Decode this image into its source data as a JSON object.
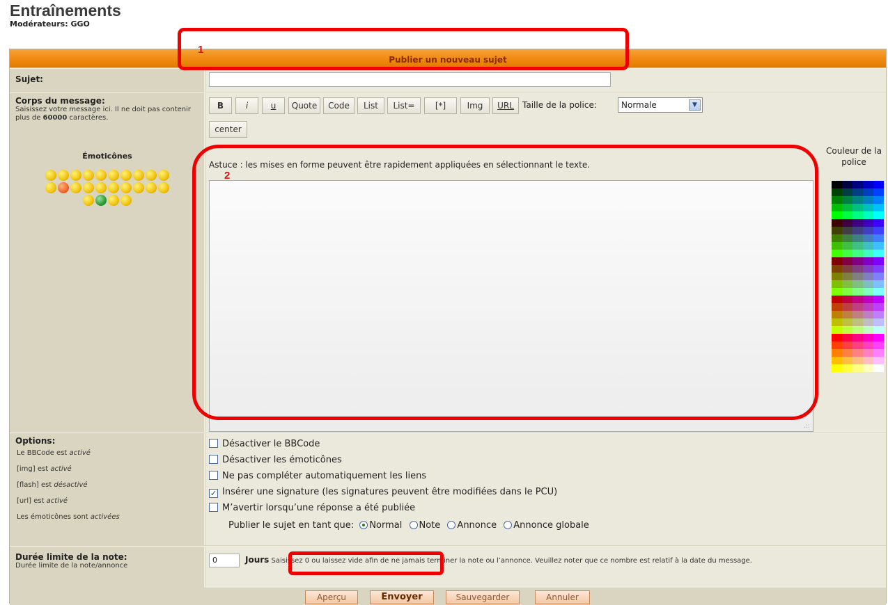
{
  "forum": {
    "title": "Entraînements",
    "moderators_label": "Modérateurs:",
    "moderators_value": "GGO"
  },
  "panel": {
    "heading": "Publier un nouveau sujet"
  },
  "subject": {
    "label": "Sujet:",
    "value": ""
  },
  "message": {
    "label": "Corps du message:",
    "desc_part1": "Saisissez votre message ici. Il ne doit pas contenir plus de ",
    "desc_max": "60000",
    "desc_part2": " caractères.",
    "emoticons_title": "Émoticônes",
    "tip": "Astuce : les mises en forme peuvent être rapidement appliquées en sélectionnant le texte.",
    "body_value": ""
  },
  "toolbar": {
    "buttons": [
      "B",
      "i",
      "u",
      "Quote",
      "Code",
      "List",
      "List=",
      "[*]",
      "Img",
      "URL",
      "center"
    ],
    "font_size_label": "Taille de la police:",
    "font_size_selected": "Normale",
    "color_label": "Couleur de la police"
  },
  "emoticons": {
    "row1": [
      "😁",
      "😀",
      "🙂",
      "😳",
      "😮",
      "😵",
      "😵",
      "😎",
      "😄",
      "😆"
    ],
    "row2": [
      "😛",
      "😡",
      "😕",
      "😠",
      "😈",
      "😏",
      "!",
      "?",
      "💡",
      "➜"
    ],
    "row3": [
      "😐",
      "😬",
      "🤓",
      "😵"
    ]
  },
  "options": {
    "label": "Options:",
    "status": [
      {
        "prefix": "Le BBCode est ",
        "state": "activé"
      },
      {
        "prefix": "[img] est ",
        "state": "activé"
      },
      {
        "prefix": "[flash] est ",
        "state": "désactivé"
      },
      {
        "prefix": "[url] est ",
        "state": "activé"
      },
      {
        "prefix": "Les émoticônes sont ",
        "state": "activées"
      }
    ],
    "checkboxes": [
      {
        "label": "Désactiver le BBCode",
        "checked": false
      },
      {
        "label": "Désactiver les émoticônes",
        "checked": false
      },
      {
        "label": "Ne pas compléter automatiquement les liens",
        "checked": false
      },
      {
        "label": "Insérer une signature (les signatures peuvent être modifiées dans le PCU)",
        "checked": true
      },
      {
        "label": "M’avertir lorsqu’une réponse a été publiée",
        "checked": false
      }
    ],
    "post_as_label": "Publier le sujet en tant que:",
    "post_as": [
      {
        "label": "Normal",
        "selected": true
      },
      {
        "label": "Note",
        "selected": false
      },
      {
        "label": "Annonce",
        "selected": false
      },
      {
        "label": "Annonce globale",
        "selected": false
      }
    ]
  },
  "duration": {
    "label": "Durée limite de la note:",
    "desc": "Durée limite de la note/annonce",
    "value": "0",
    "unit": "Jours",
    "help": "Saisissez 0 ou laissez vide afin de ne jamais terminer la note ou l’annonce. Veuillez noter que ce nombre est relatif à la date du message."
  },
  "actions": {
    "preview": "Aperçu",
    "submit": "Envoyer",
    "save": "Sauvegarder",
    "cancel": "Annuler"
  },
  "annotations": {
    "one": "1",
    "two": "2",
    "color": "#ee0000"
  },
  "palette_colors": [
    "#000000",
    "#000040",
    "#000080",
    "#0000bf",
    "#0000ff",
    "#004000",
    "#004040",
    "#004080",
    "#0040bf",
    "#0040ff",
    "#008000",
    "#008040",
    "#008080",
    "#0080bf",
    "#0080ff",
    "#00bf00",
    "#00bf40",
    "#00bf80",
    "#00bfbf",
    "#00bfff",
    "#00ff00",
    "#00ff40",
    "#00ff80",
    "#00ffbf",
    "#00ffff",
    "#400000",
    "#400040",
    "#400080",
    "#4000bf",
    "#4000ff",
    "#404000",
    "#404040",
    "#404080",
    "#4040bf",
    "#4040ff",
    "#408000",
    "#408040",
    "#408080",
    "#4080bf",
    "#4080ff",
    "#40bf00",
    "#40bf40",
    "#40bf80",
    "#40bfbf",
    "#40bfff",
    "#40ff00",
    "#40ff40",
    "#40ff80",
    "#40ffbf",
    "#40ffff",
    "#800000",
    "#800040",
    "#800080",
    "#8000bf",
    "#8000ff",
    "#804000",
    "#804040",
    "#804080",
    "#8040bf",
    "#8040ff",
    "#808000",
    "#808040",
    "#808080",
    "#8080bf",
    "#8080ff",
    "#80bf00",
    "#80bf40",
    "#80bf80",
    "#80bfbf",
    "#80bfff",
    "#80ff00",
    "#80ff40",
    "#80ff80",
    "#80ffbf",
    "#80ffff",
    "#bf0000",
    "#bf0040",
    "#bf0080",
    "#bf00bf",
    "#bf00ff",
    "#bf4000",
    "#bf4040",
    "#bf4080",
    "#bf40bf",
    "#bf40ff",
    "#bf8000",
    "#bf8040",
    "#bf8080",
    "#bf80bf",
    "#bf80ff",
    "#bfbf00",
    "#bfbf40",
    "#bfbf80",
    "#bfbfbf",
    "#bfbfff",
    "#bfff00",
    "#bfff40",
    "#bfff80",
    "#bfffbf",
    "#bfffff",
    "#ff0000",
    "#ff0040",
    "#ff0080",
    "#ff00bf",
    "#ff00ff",
    "#ff4000",
    "#ff4040",
    "#ff4080",
    "#ff40bf",
    "#ff40ff",
    "#ff8000",
    "#ff8040",
    "#ff8080",
    "#ff80bf",
    "#ff80ff",
    "#ffbf00",
    "#ffbf40",
    "#ffbf80",
    "#ffbfbf",
    "#ffbfff",
    "#ffff00",
    "#ffff40",
    "#ffff80",
    "#ffffbf",
    "#ffffff"
  ]
}
